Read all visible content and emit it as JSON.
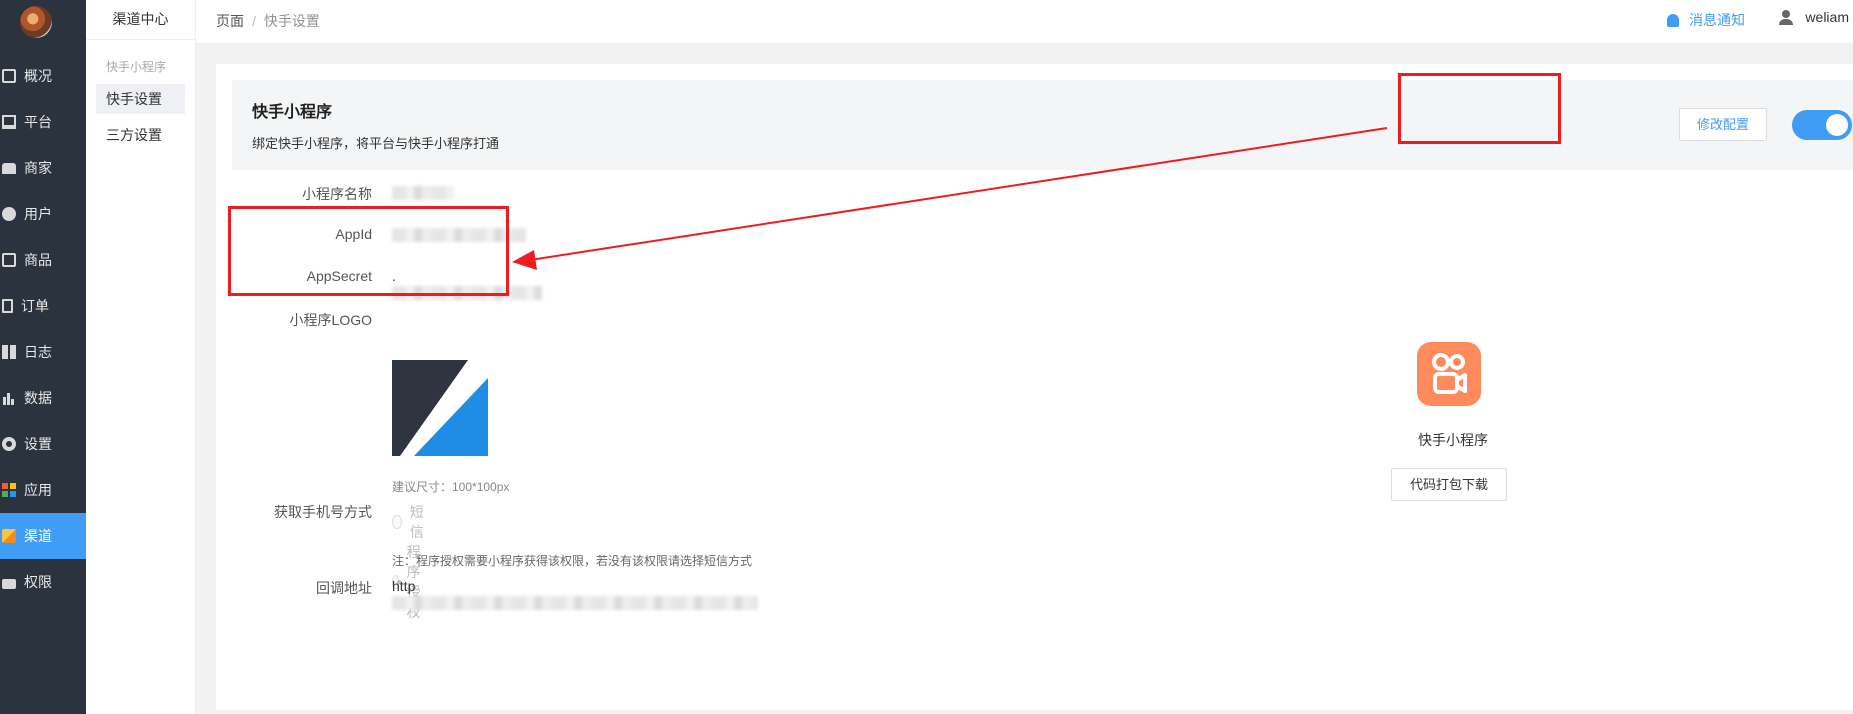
{
  "sidebar": {
    "items": [
      {
        "label": "概况",
        "icon": "dashboard-icon"
      },
      {
        "label": "平台",
        "icon": "monitor-icon"
      },
      {
        "label": "商家",
        "icon": "store-icon"
      },
      {
        "label": "用户",
        "icon": "user-icon"
      },
      {
        "label": "商品",
        "icon": "bag-icon"
      },
      {
        "label": "订单",
        "icon": "clipboard-icon"
      },
      {
        "label": "日志",
        "icon": "book-icon"
      },
      {
        "label": "数据",
        "icon": "bar-chart-icon"
      },
      {
        "label": "设置",
        "icon": "gear-icon"
      },
      {
        "label": "应用",
        "icon": "apps-grid-icon"
      },
      {
        "label": "渠道",
        "icon": "cube-icon",
        "active": true
      },
      {
        "label": "权限",
        "icon": "lock-icon"
      }
    ]
  },
  "subnav": {
    "title": "渠道中心",
    "group": "快手小程序",
    "items": [
      {
        "label": "快手设置",
        "active": true
      },
      {
        "label": "三方设置"
      }
    ]
  },
  "header": {
    "breadcrumb": [
      "页面",
      "快手设置"
    ],
    "notification": "消息通知",
    "username": "weliam"
  },
  "panel": {
    "title": "快手小程序",
    "description": "绑定快手小程序，将平台与快手小程序打通",
    "edit_button": "修改配置",
    "enabled": true
  },
  "form": {
    "name_label": "小程序名称",
    "appid_label": "AppId",
    "appsecret_label": "AppSecret",
    "appsecret_prefix": ".",
    "logo_label": "小程序LOGO",
    "logo_hint": "建议尺寸：100*100px",
    "phone_label": "获取手机号方式",
    "phone_options": [
      "短信",
      "程序授权"
    ],
    "phone_selected": "程序授权",
    "phone_note": "注：程序授权需要小程序获得该权限，若没有该权限请选择短信方式",
    "callback_label": "回调地址",
    "callback_prefix": "http"
  },
  "kuaishou": {
    "name": "快手小程序",
    "download_button": "代码打包下载",
    "brand_color": "#ff8a5b"
  },
  "colors": {
    "accent": "#419cf5",
    "sidebar_bg": "#2b333e",
    "annotation": "#ee1c1c"
  }
}
